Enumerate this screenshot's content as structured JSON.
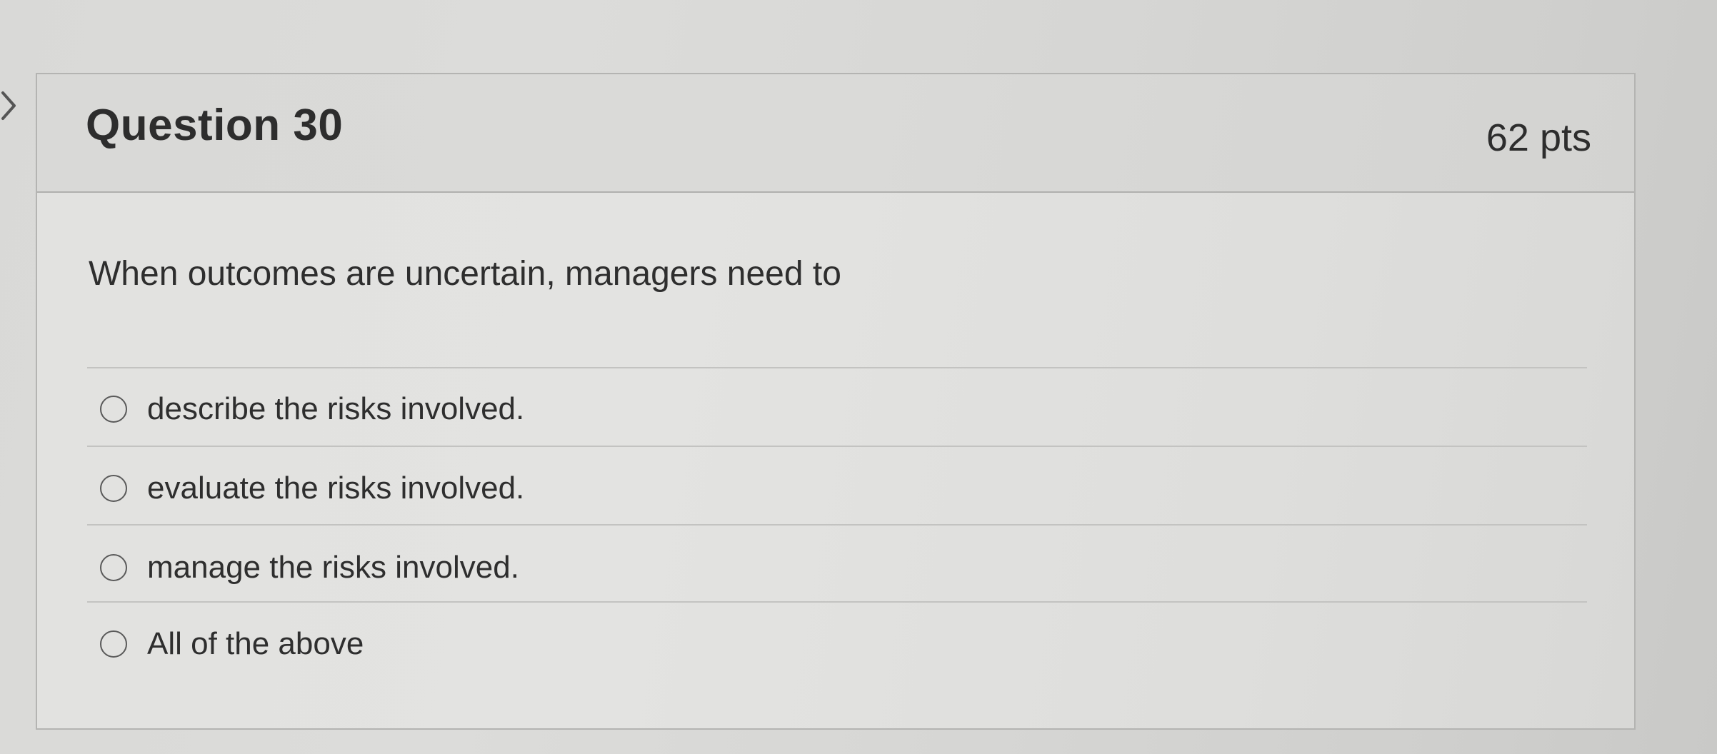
{
  "question": {
    "title": "Question 30",
    "points": "62 pts",
    "text": "When outcomes are uncertain, managers need to"
  },
  "answers": [
    {
      "label": "describe the risks involved.",
      "selected": false
    },
    {
      "label": "evaluate the risks involved.",
      "selected": false
    },
    {
      "label": "manage the risks involved.",
      "selected": false
    },
    {
      "label": "All of the above",
      "selected": false
    }
  ],
  "icons": {
    "nav": "chevron-right-icon",
    "answer": "radio-button-icon"
  },
  "colors": {
    "text": "#2d2d2d",
    "card_background": "#e2e2e0",
    "header_background": "#d9d9d7",
    "border": "#b4b4b2"
  }
}
